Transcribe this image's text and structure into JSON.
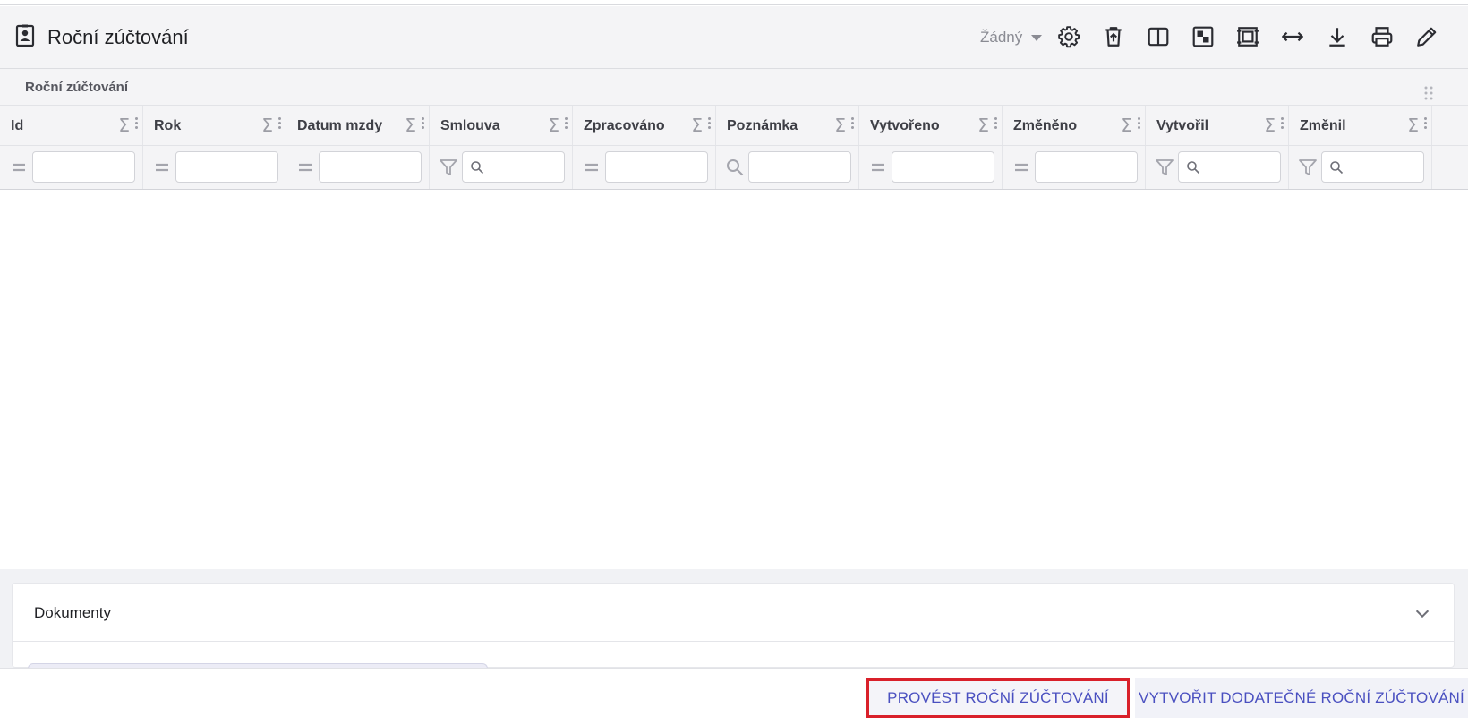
{
  "header": {
    "title": "Roční zúčtování",
    "title_icon": "contact-card-icon",
    "view_select": "Žádný",
    "toolbar_icons": [
      "settings-icon",
      "delete-upload-icon",
      "split-view-icon",
      "layout-icon",
      "fit-screen-icon",
      "expand-width-icon",
      "download-icon",
      "print-icon",
      "edit-icon"
    ]
  },
  "grid": {
    "group_label": "Roční zúčtování",
    "columns": [
      {
        "label": "Id",
        "filter": "equals"
      },
      {
        "label": "Rok",
        "filter": "equals"
      },
      {
        "label": "Datum mzdy",
        "filter": "equals"
      },
      {
        "label": "Smlouva",
        "filter": "funnel-search"
      },
      {
        "label": "Zpracováno",
        "filter": "equals"
      },
      {
        "label": "Poznámka",
        "filter": "search"
      },
      {
        "label": "Vytvořeno",
        "filter": "equals"
      },
      {
        "label": "Změněno",
        "filter": "equals"
      },
      {
        "label": "Vytvořil",
        "filter": "funnel-search"
      },
      {
        "label": "Změnil",
        "filter": "funnel-search"
      }
    ],
    "sigma": "Σ"
  },
  "documents": {
    "title": "Dokumenty"
  },
  "footer": {
    "primary_button": "PROVÉST ROČNÍ ZÚČTOVÁNÍ",
    "secondary_button": "VYTVOŘIT DODATEČNÉ ROČNÍ ZÚČTOVÁNÍ"
  },
  "colors": {
    "accent": "#4a50c0",
    "highlight": "#d9202a",
    "header_bg": "#f4f4f6"
  }
}
